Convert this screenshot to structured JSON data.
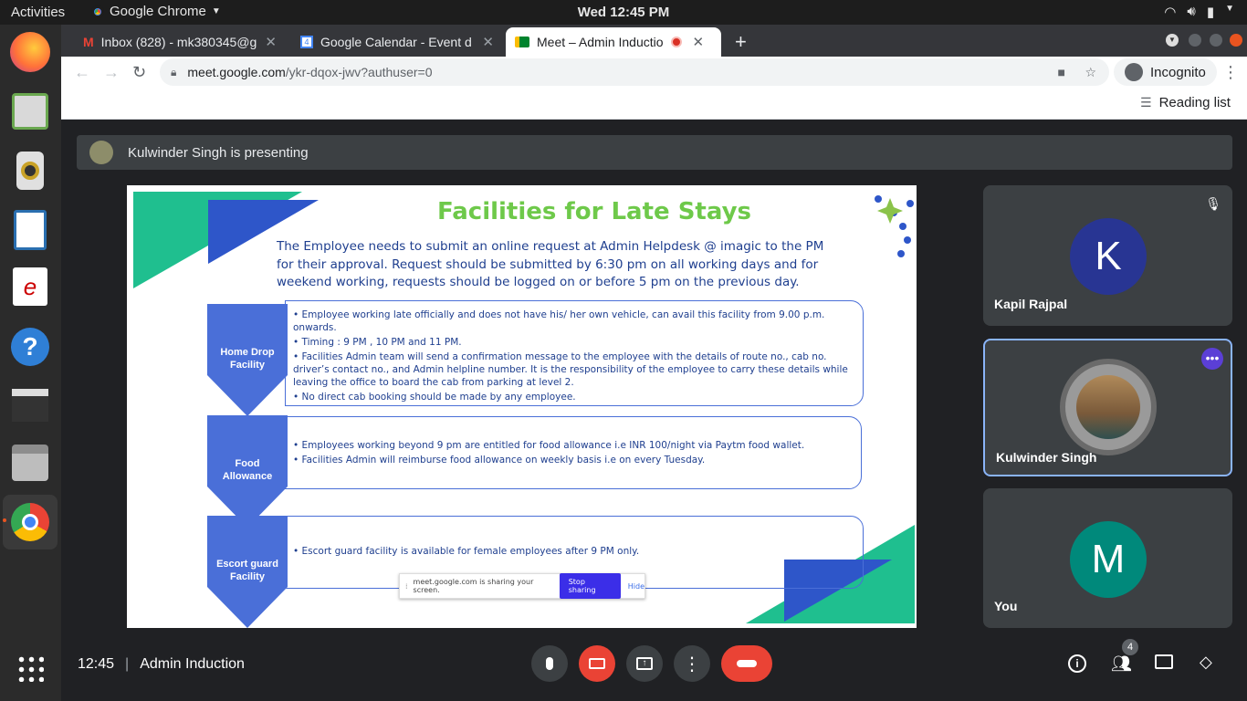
{
  "system_bar": {
    "activities": "Activities",
    "app_name": "Google Chrome",
    "clock": "Wed 12:45 PM"
  },
  "browser": {
    "tabs": [
      {
        "label": "Inbox (828) - mk380345@g",
        "icon": "gmail-icon"
      },
      {
        "label": "Google Calendar - Event d",
        "icon": "calendar-icon"
      },
      {
        "label": "Meet – Admin Inductio",
        "icon": "meet-icon",
        "active": true
      }
    ],
    "url_host": "meet.google.com",
    "url_path": "/ykr-dqox-jwv?authuser=0",
    "incognito_label": "Incognito",
    "reading_list": "Reading list"
  },
  "meet": {
    "presenting_banner": "Kulwinder Singh is presenting",
    "slide": {
      "title": "Facilities for Late Stays",
      "intro": "The Employee needs to submit an online request at Admin Helpdesk @ imagic to the PM for their approval. Request should be submitted by 6:30 pm on all working days and for weekend working, requests should be logged on or before 5 pm on the previous day.",
      "sections": [
        {
          "label_line1": "Home Drop",
          "label_line2": "Facility",
          "bullets": [
            "Employee working late officially and does not have his/ her own vehicle, can avail this facility from 9.00 p.m. onwards.",
            "Timing : 9 PM , 10 PM and 11 PM.",
            "Facilities Admin team will send a confirmation message to the employee with the details of route no., cab no. driver’s contact no., and Admin helpline number. It is the responsibility of the employee to carry these details while leaving the office to board the cab from parking at level 2.",
            "No direct cab booking should be made by any employee."
          ]
        },
        {
          "label_line1": "Food",
          "label_line2": "Allowance",
          "bullets": [
            "Employees working beyond 9 pm are entitled for food allowance i.e INR 100/night via Paytm food wallet.",
            "Facilities Admin will reimburse food allowance on weekly basis i.e on every Tuesday."
          ]
        },
        {
          "label_line1": "Escort guard",
          "label_line2": "Facility",
          "bullets": [
            "Escort guard facility is available for female employees after 9 PM only."
          ]
        }
      ],
      "share_bar": {
        "text": "meet.google.com is sharing your screen.",
        "stop": "Stop sharing",
        "hide": "Hide"
      }
    },
    "participants": [
      {
        "name": "Kapil Rajpal",
        "initial": "K",
        "color": "#283593",
        "muted": true
      },
      {
        "name": "Kulwinder Singh",
        "initial": "",
        "color": "#5f6368",
        "active": true
      },
      {
        "name": "You",
        "initial": "M",
        "color": "#00897b"
      }
    ],
    "time": "12:45",
    "meeting_name": "Admin Induction",
    "participant_count": "4"
  }
}
